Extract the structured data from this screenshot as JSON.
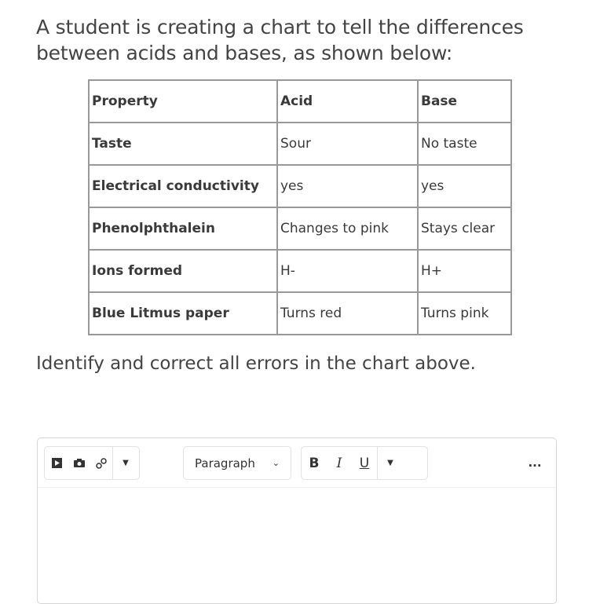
{
  "question": "A student is creating a chart to tell the differences between acids and bases, as shown below:",
  "table": {
    "headers": [
      "Property",
      "Acid",
      "Base"
    ],
    "rows": [
      [
        "Taste",
        "Sour",
        "No taste"
      ],
      [
        "Electrical conductivity",
        "yes",
        "yes"
      ],
      [
        "Phenolphthalein",
        "Changes to pink",
        "Stays clear"
      ],
      [
        "Ions formed",
        "H-",
        "H+"
      ],
      [
        "Blue Litmus paper",
        "Turns red",
        "Turns pink"
      ]
    ]
  },
  "instruction": "Identify and correct all errors in the chart above.",
  "toolbar": {
    "block_format": "Paragraph",
    "bold": "B",
    "italic": "I",
    "underline": "U",
    "more": "..."
  }
}
